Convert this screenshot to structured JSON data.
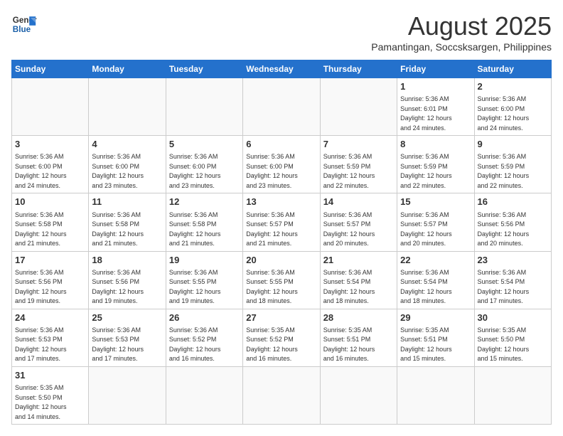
{
  "logo": {
    "line1": "General",
    "line2": "Blue"
  },
  "title": "August 2025",
  "location": "Pamantingan, Soccsksargen, Philippines",
  "weekdays": [
    "Sunday",
    "Monday",
    "Tuesday",
    "Wednesday",
    "Thursday",
    "Friday",
    "Saturday"
  ],
  "weeks": [
    [
      {
        "day": "",
        "info": ""
      },
      {
        "day": "",
        "info": ""
      },
      {
        "day": "",
        "info": ""
      },
      {
        "day": "",
        "info": ""
      },
      {
        "day": "",
        "info": ""
      },
      {
        "day": "1",
        "info": "Sunrise: 5:36 AM\nSunset: 6:01 PM\nDaylight: 12 hours\nand 24 minutes."
      },
      {
        "day": "2",
        "info": "Sunrise: 5:36 AM\nSunset: 6:00 PM\nDaylight: 12 hours\nand 24 minutes."
      }
    ],
    [
      {
        "day": "3",
        "info": "Sunrise: 5:36 AM\nSunset: 6:00 PM\nDaylight: 12 hours\nand 24 minutes."
      },
      {
        "day": "4",
        "info": "Sunrise: 5:36 AM\nSunset: 6:00 PM\nDaylight: 12 hours\nand 23 minutes."
      },
      {
        "day": "5",
        "info": "Sunrise: 5:36 AM\nSunset: 6:00 PM\nDaylight: 12 hours\nand 23 minutes."
      },
      {
        "day": "6",
        "info": "Sunrise: 5:36 AM\nSunset: 6:00 PM\nDaylight: 12 hours\nand 23 minutes."
      },
      {
        "day": "7",
        "info": "Sunrise: 5:36 AM\nSunset: 5:59 PM\nDaylight: 12 hours\nand 22 minutes."
      },
      {
        "day": "8",
        "info": "Sunrise: 5:36 AM\nSunset: 5:59 PM\nDaylight: 12 hours\nand 22 minutes."
      },
      {
        "day": "9",
        "info": "Sunrise: 5:36 AM\nSunset: 5:59 PM\nDaylight: 12 hours\nand 22 minutes."
      }
    ],
    [
      {
        "day": "10",
        "info": "Sunrise: 5:36 AM\nSunset: 5:58 PM\nDaylight: 12 hours\nand 21 minutes."
      },
      {
        "day": "11",
        "info": "Sunrise: 5:36 AM\nSunset: 5:58 PM\nDaylight: 12 hours\nand 21 minutes."
      },
      {
        "day": "12",
        "info": "Sunrise: 5:36 AM\nSunset: 5:58 PM\nDaylight: 12 hours\nand 21 minutes."
      },
      {
        "day": "13",
        "info": "Sunrise: 5:36 AM\nSunset: 5:57 PM\nDaylight: 12 hours\nand 21 minutes."
      },
      {
        "day": "14",
        "info": "Sunrise: 5:36 AM\nSunset: 5:57 PM\nDaylight: 12 hours\nand 20 minutes."
      },
      {
        "day": "15",
        "info": "Sunrise: 5:36 AM\nSunset: 5:57 PM\nDaylight: 12 hours\nand 20 minutes."
      },
      {
        "day": "16",
        "info": "Sunrise: 5:36 AM\nSunset: 5:56 PM\nDaylight: 12 hours\nand 20 minutes."
      }
    ],
    [
      {
        "day": "17",
        "info": "Sunrise: 5:36 AM\nSunset: 5:56 PM\nDaylight: 12 hours\nand 19 minutes."
      },
      {
        "day": "18",
        "info": "Sunrise: 5:36 AM\nSunset: 5:56 PM\nDaylight: 12 hours\nand 19 minutes."
      },
      {
        "day": "19",
        "info": "Sunrise: 5:36 AM\nSunset: 5:55 PM\nDaylight: 12 hours\nand 19 minutes."
      },
      {
        "day": "20",
        "info": "Sunrise: 5:36 AM\nSunset: 5:55 PM\nDaylight: 12 hours\nand 18 minutes."
      },
      {
        "day": "21",
        "info": "Sunrise: 5:36 AM\nSunset: 5:54 PM\nDaylight: 12 hours\nand 18 minutes."
      },
      {
        "day": "22",
        "info": "Sunrise: 5:36 AM\nSunset: 5:54 PM\nDaylight: 12 hours\nand 18 minutes."
      },
      {
        "day": "23",
        "info": "Sunrise: 5:36 AM\nSunset: 5:54 PM\nDaylight: 12 hours\nand 17 minutes."
      }
    ],
    [
      {
        "day": "24",
        "info": "Sunrise: 5:36 AM\nSunset: 5:53 PM\nDaylight: 12 hours\nand 17 minutes."
      },
      {
        "day": "25",
        "info": "Sunrise: 5:36 AM\nSunset: 5:53 PM\nDaylight: 12 hours\nand 17 minutes."
      },
      {
        "day": "26",
        "info": "Sunrise: 5:36 AM\nSunset: 5:52 PM\nDaylight: 12 hours\nand 16 minutes."
      },
      {
        "day": "27",
        "info": "Sunrise: 5:35 AM\nSunset: 5:52 PM\nDaylight: 12 hours\nand 16 minutes."
      },
      {
        "day": "28",
        "info": "Sunrise: 5:35 AM\nSunset: 5:51 PM\nDaylight: 12 hours\nand 16 minutes."
      },
      {
        "day": "29",
        "info": "Sunrise: 5:35 AM\nSunset: 5:51 PM\nDaylight: 12 hours\nand 15 minutes."
      },
      {
        "day": "30",
        "info": "Sunrise: 5:35 AM\nSunset: 5:50 PM\nDaylight: 12 hours\nand 15 minutes."
      }
    ],
    [
      {
        "day": "31",
        "info": "Sunrise: 5:35 AM\nSunset: 5:50 PM\nDaylight: 12 hours\nand 14 minutes."
      },
      {
        "day": "",
        "info": ""
      },
      {
        "day": "",
        "info": ""
      },
      {
        "day": "",
        "info": ""
      },
      {
        "day": "",
        "info": ""
      },
      {
        "day": "",
        "info": ""
      },
      {
        "day": "",
        "info": ""
      }
    ]
  ]
}
